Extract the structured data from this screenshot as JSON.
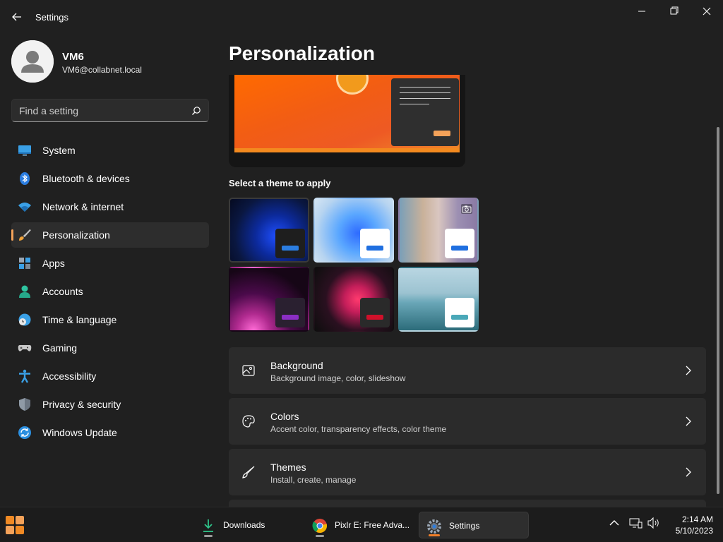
{
  "window": {
    "title": "Settings"
  },
  "profile": {
    "name": "VM6",
    "email": "VM6@collabnet.local"
  },
  "search": {
    "placeholder": "Find a setting"
  },
  "nav": {
    "items": [
      {
        "label": "System",
        "icon": "monitor-icon"
      },
      {
        "label": "Bluetooth & devices",
        "icon": "bluetooth-icon"
      },
      {
        "label": "Network & internet",
        "icon": "wifi-icon"
      },
      {
        "label": "Personalization",
        "icon": "brush-icon",
        "active": true
      },
      {
        "label": "Apps",
        "icon": "apps-icon"
      },
      {
        "label": "Accounts",
        "icon": "person-icon"
      },
      {
        "label": "Time & language",
        "icon": "globe-clock-icon"
      },
      {
        "label": "Gaming",
        "icon": "gamepad-icon"
      },
      {
        "label": "Accessibility",
        "icon": "accessibility-icon"
      },
      {
        "label": "Privacy & security",
        "icon": "shield-icon"
      },
      {
        "label": "Windows Update",
        "icon": "update-icon"
      }
    ]
  },
  "main": {
    "title": "Personalization",
    "themes_label": "Select a theme to apply",
    "cards": [
      {
        "title": "Background",
        "subtitle": "Background image, color, slideshow",
        "icon": "image-icon"
      },
      {
        "title": "Colors",
        "subtitle": "Accent color, transparency effects, color theme",
        "icon": "palette-icon"
      },
      {
        "title": "Themes",
        "subtitle": "Install, create, manage",
        "icon": "brush-icon"
      }
    ]
  },
  "colors": {
    "accent": "#f4a259",
    "background": "#202020",
    "card": "#2b2b2b"
  },
  "taskbar": {
    "apps": [
      {
        "label": "Downloads",
        "icon": "download-icon"
      },
      {
        "label": "Pixlr E: Free Adva...",
        "icon": "chrome-icon"
      },
      {
        "label": "Settings",
        "icon": "gear-icon",
        "active": true
      }
    ],
    "time": "2:14 AM",
    "date": "5/10/2023"
  }
}
